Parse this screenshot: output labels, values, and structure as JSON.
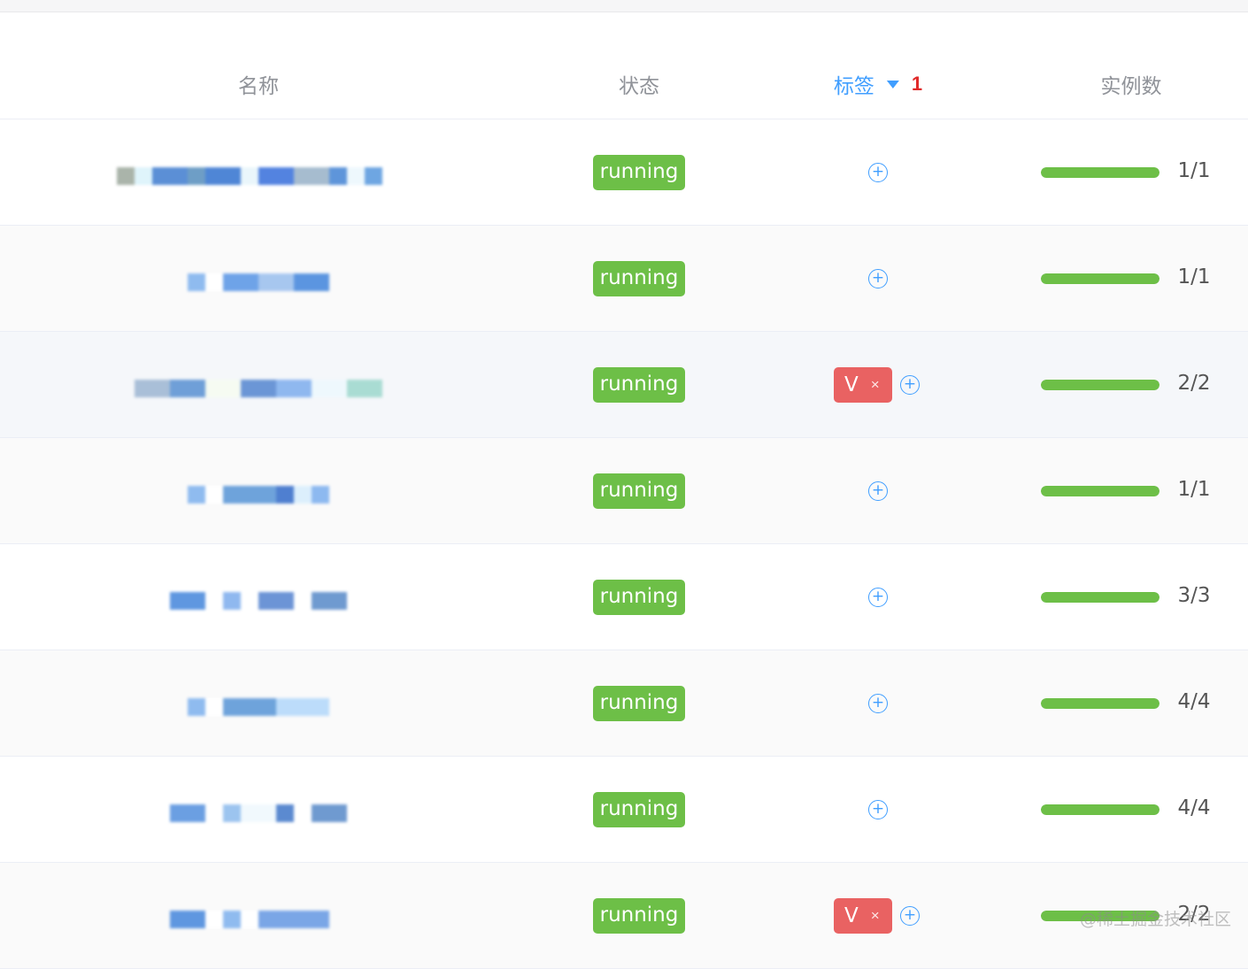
{
  "columns": {
    "name": "名称",
    "status": "状态",
    "tags": "标签",
    "tags_filter_count": "1",
    "instances": "实例数"
  },
  "colors": {
    "status_running": "#6dbf47",
    "tag_bg": "#e96262",
    "accent": "#409eff",
    "filter_count": "#e02b2b"
  },
  "rows": [
    {
      "name_redacted": true,
      "status": "running",
      "tags": [],
      "instances": "1/1",
      "progress": 1.0
    },
    {
      "name_redacted": true,
      "status": "running",
      "tags": [],
      "instances": "1/1",
      "progress": 1.0
    },
    {
      "name_redacted": true,
      "status": "running",
      "tags": [
        "V"
      ],
      "instances": "2/2",
      "progress": 1.0
    },
    {
      "name_redacted": true,
      "status": "running",
      "tags": [],
      "instances": "1/1",
      "progress": 1.0
    },
    {
      "name_redacted": true,
      "status": "running",
      "tags": [],
      "instances": "3/3",
      "progress": 1.0
    },
    {
      "name_redacted": true,
      "status": "running",
      "tags": [],
      "instances": "4/4",
      "progress": 1.0
    },
    {
      "name_redacted": true,
      "status": "running",
      "tags": [],
      "instances": "4/4",
      "progress": 1.0
    },
    {
      "name_redacted": true,
      "status": "running",
      "tags": [
        "V"
      ],
      "instances": "2/2",
      "progress": 1.0
    }
  ],
  "tag_remove_glyph": "×",
  "add_tag_glyph": "+",
  "add_tag_icon": "plus-circle-icon",
  "filter_icon": "caret-down-icon",
  "watermark": "@稀土掘金技术社区"
}
